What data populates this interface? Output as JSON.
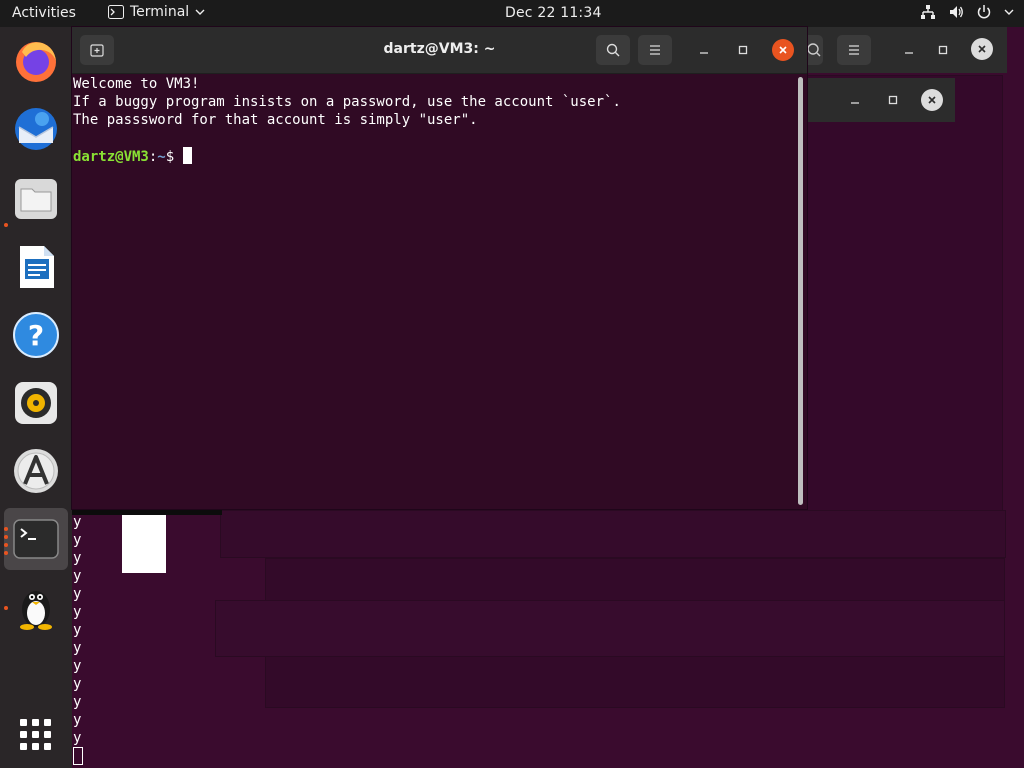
{
  "topbar": {
    "activities": "Activities",
    "app_name": "Terminal",
    "clock": "Dec 22  11:34"
  },
  "dock": {
    "items": [
      "firefox-icon",
      "thunderbird-icon",
      "files-icon",
      "writer-icon",
      "help-icon",
      "rhythmbox-icon",
      "software-icon",
      "terminal-icon",
      "tux-icon"
    ],
    "show_apps": "grid-icon"
  },
  "terminal": {
    "title": "dartz@VM3: ~",
    "lines": [
      "Welcome to VM3!",
      "If a buggy program insists on a password, use the account `user`.",
      "The passsword for that account is simply \"user\"."
    ],
    "prompt_user": "dartz@VM3",
    "prompt_colon": ":",
    "prompt_path": "~",
    "prompt_symbol": "$ "
  },
  "leaked_output": {
    "char": "y",
    "count": 13
  },
  "colors": {
    "desktop": "#3a0b2e",
    "terminal_bg": "#300a24",
    "accent": "#e95420"
  }
}
